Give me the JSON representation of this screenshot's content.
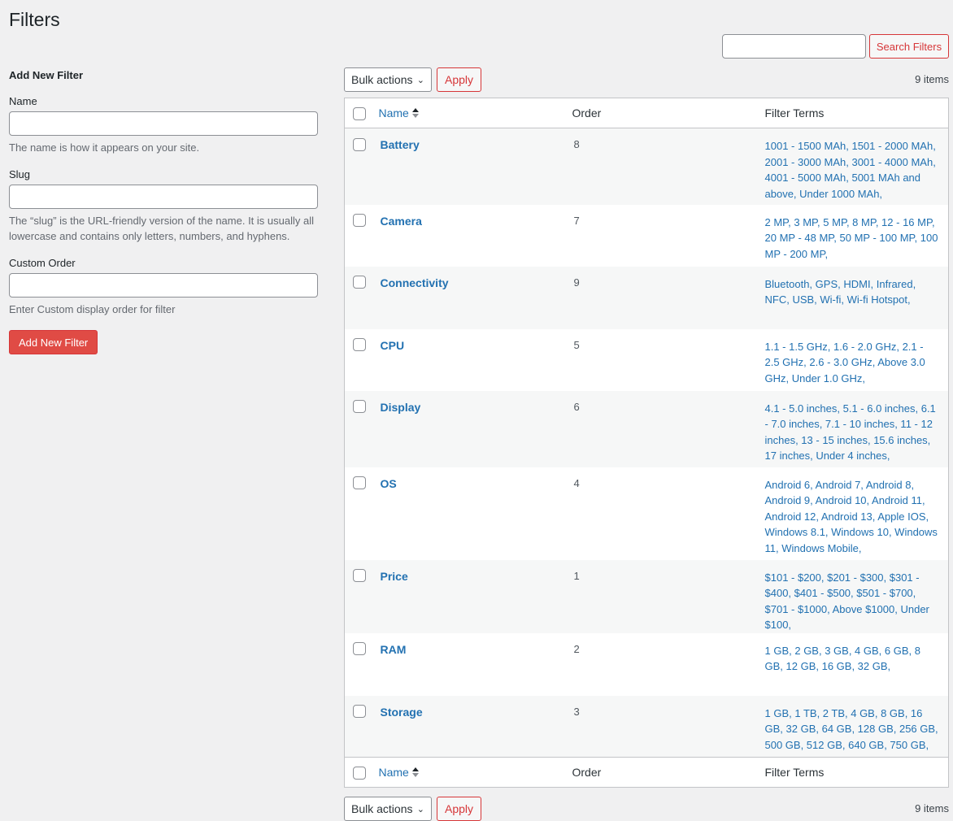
{
  "page": {
    "title": "Filters"
  },
  "search": {
    "placeholder": "",
    "button_label": "Search Filters"
  },
  "form": {
    "heading": "Add New Filter",
    "name_label": "Name",
    "name_desc": "The name is how it appears on your site.",
    "slug_label": "Slug",
    "slug_desc": "The “slug” is the URL-friendly version of the name. It is usually all lowercase and contains only letters, numbers, and hyphens.",
    "order_label": "Custom Order",
    "order_desc": "Enter Custom display order for filter",
    "submit_label": "Add New Filter"
  },
  "tablenav": {
    "bulk_label": "Bulk actions",
    "apply_label": "Apply",
    "count_label": "9 items"
  },
  "table": {
    "columns": {
      "name": "Name",
      "order": "Order",
      "terms": "Filter Terms"
    },
    "rows": [
      {
        "name": "Battery",
        "order": "8",
        "terms": "1001 - 1500 MAh, 1501 - 2000 MAh, 2001 - 3000 MAh, 3001 - 4000 MAh, 4001 - 5000 MAh, 5001 MAh and above, Under 1000 MAh,"
      },
      {
        "name": "Camera",
        "order": "7",
        "terms": "2 MP, 3 MP, 5 MP, 8 MP, 12 - 16 MP, 20 MP - 48 MP, 50 MP - 100 MP, 100 MP - 200 MP,"
      },
      {
        "name": "Connectivity",
        "order": "9",
        "terms": "Bluetooth, GPS, HDMI, Infrared, NFC, USB, Wi-fi, Wi-fi Hotspot,"
      },
      {
        "name": "CPU",
        "order": "5",
        "terms": "1.1 - 1.5 GHz, 1.6 - 2.0 GHz, 2.1 - 2.5 GHz, 2.6 - 3.0 GHz, Above 3.0 GHz, Under 1.0 GHz,"
      },
      {
        "name": "Display",
        "order": "6",
        "terms": "4.1 - 5.0 inches, 5.1 - 6.0 inches, 6.1 - 7.0 inches, 7.1 - 10 inches, 11 - 12 inches, 13 - 15 inches, 15.6 inches, 17 inches, Under 4 inches,"
      },
      {
        "name": "OS",
        "order": "4",
        "terms": "Android 6, Android 7, Android 8, Android 9, Android 10, Android 11, Android 12, Android 13, Apple IOS, Windows 8.1, Windows 10, Windows 11, Windows Mobile,"
      },
      {
        "name": "Price",
        "order": "1",
        "terms": "$101 - $200, $201 - $300, $301 - $400, $401 - $500, $501 - $700, $701 - $1000, Above $1000, Under $100,"
      },
      {
        "name": "RAM",
        "order": "2",
        "terms": "1 GB, 2 GB, 3 GB, 4 GB, 6 GB, 8 GB, 12 GB, 16 GB, 32 GB,"
      },
      {
        "name": "Storage",
        "order": "3",
        "terms": "1 GB, 1 TB, 2 TB, 4 GB, 8 GB, 16 GB, 32 GB, 64 GB, 128 GB, 256 GB, 500 GB, 512 GB, 640 GB, 750 GB,"
      }
    ]
  }
}
